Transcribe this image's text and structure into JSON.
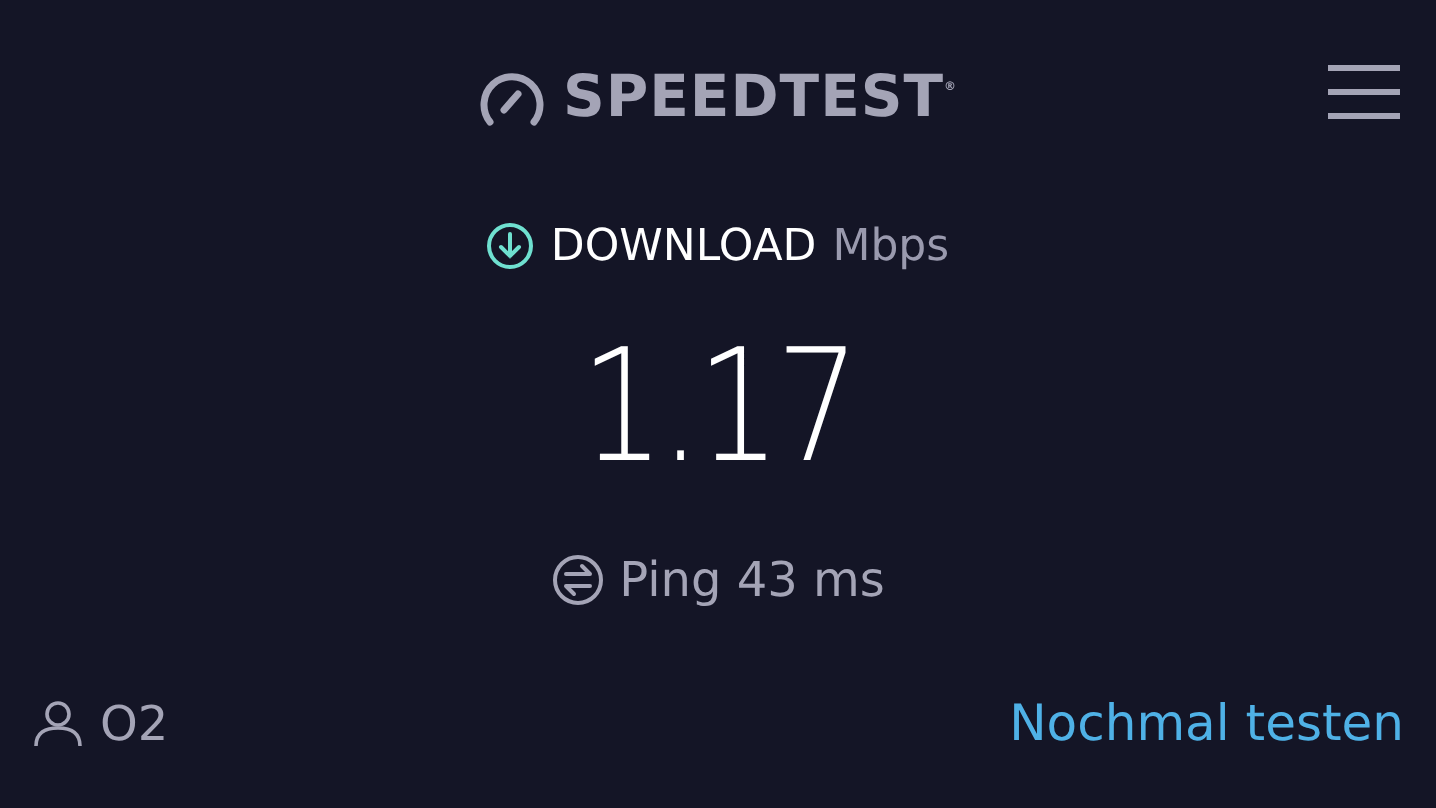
{
  "header": {
    "logo": "SPEEDTEST$^{®}$"
  },
  "result": {
    "label": "DOWNLOAD",
    "unit": "Mbps",
    "value": "1.17",
    "ping": "Ping 43 ms"
  },
  "footer": {
    "provider": "O2",
    "action": "Nochmal testen"
  }
}
